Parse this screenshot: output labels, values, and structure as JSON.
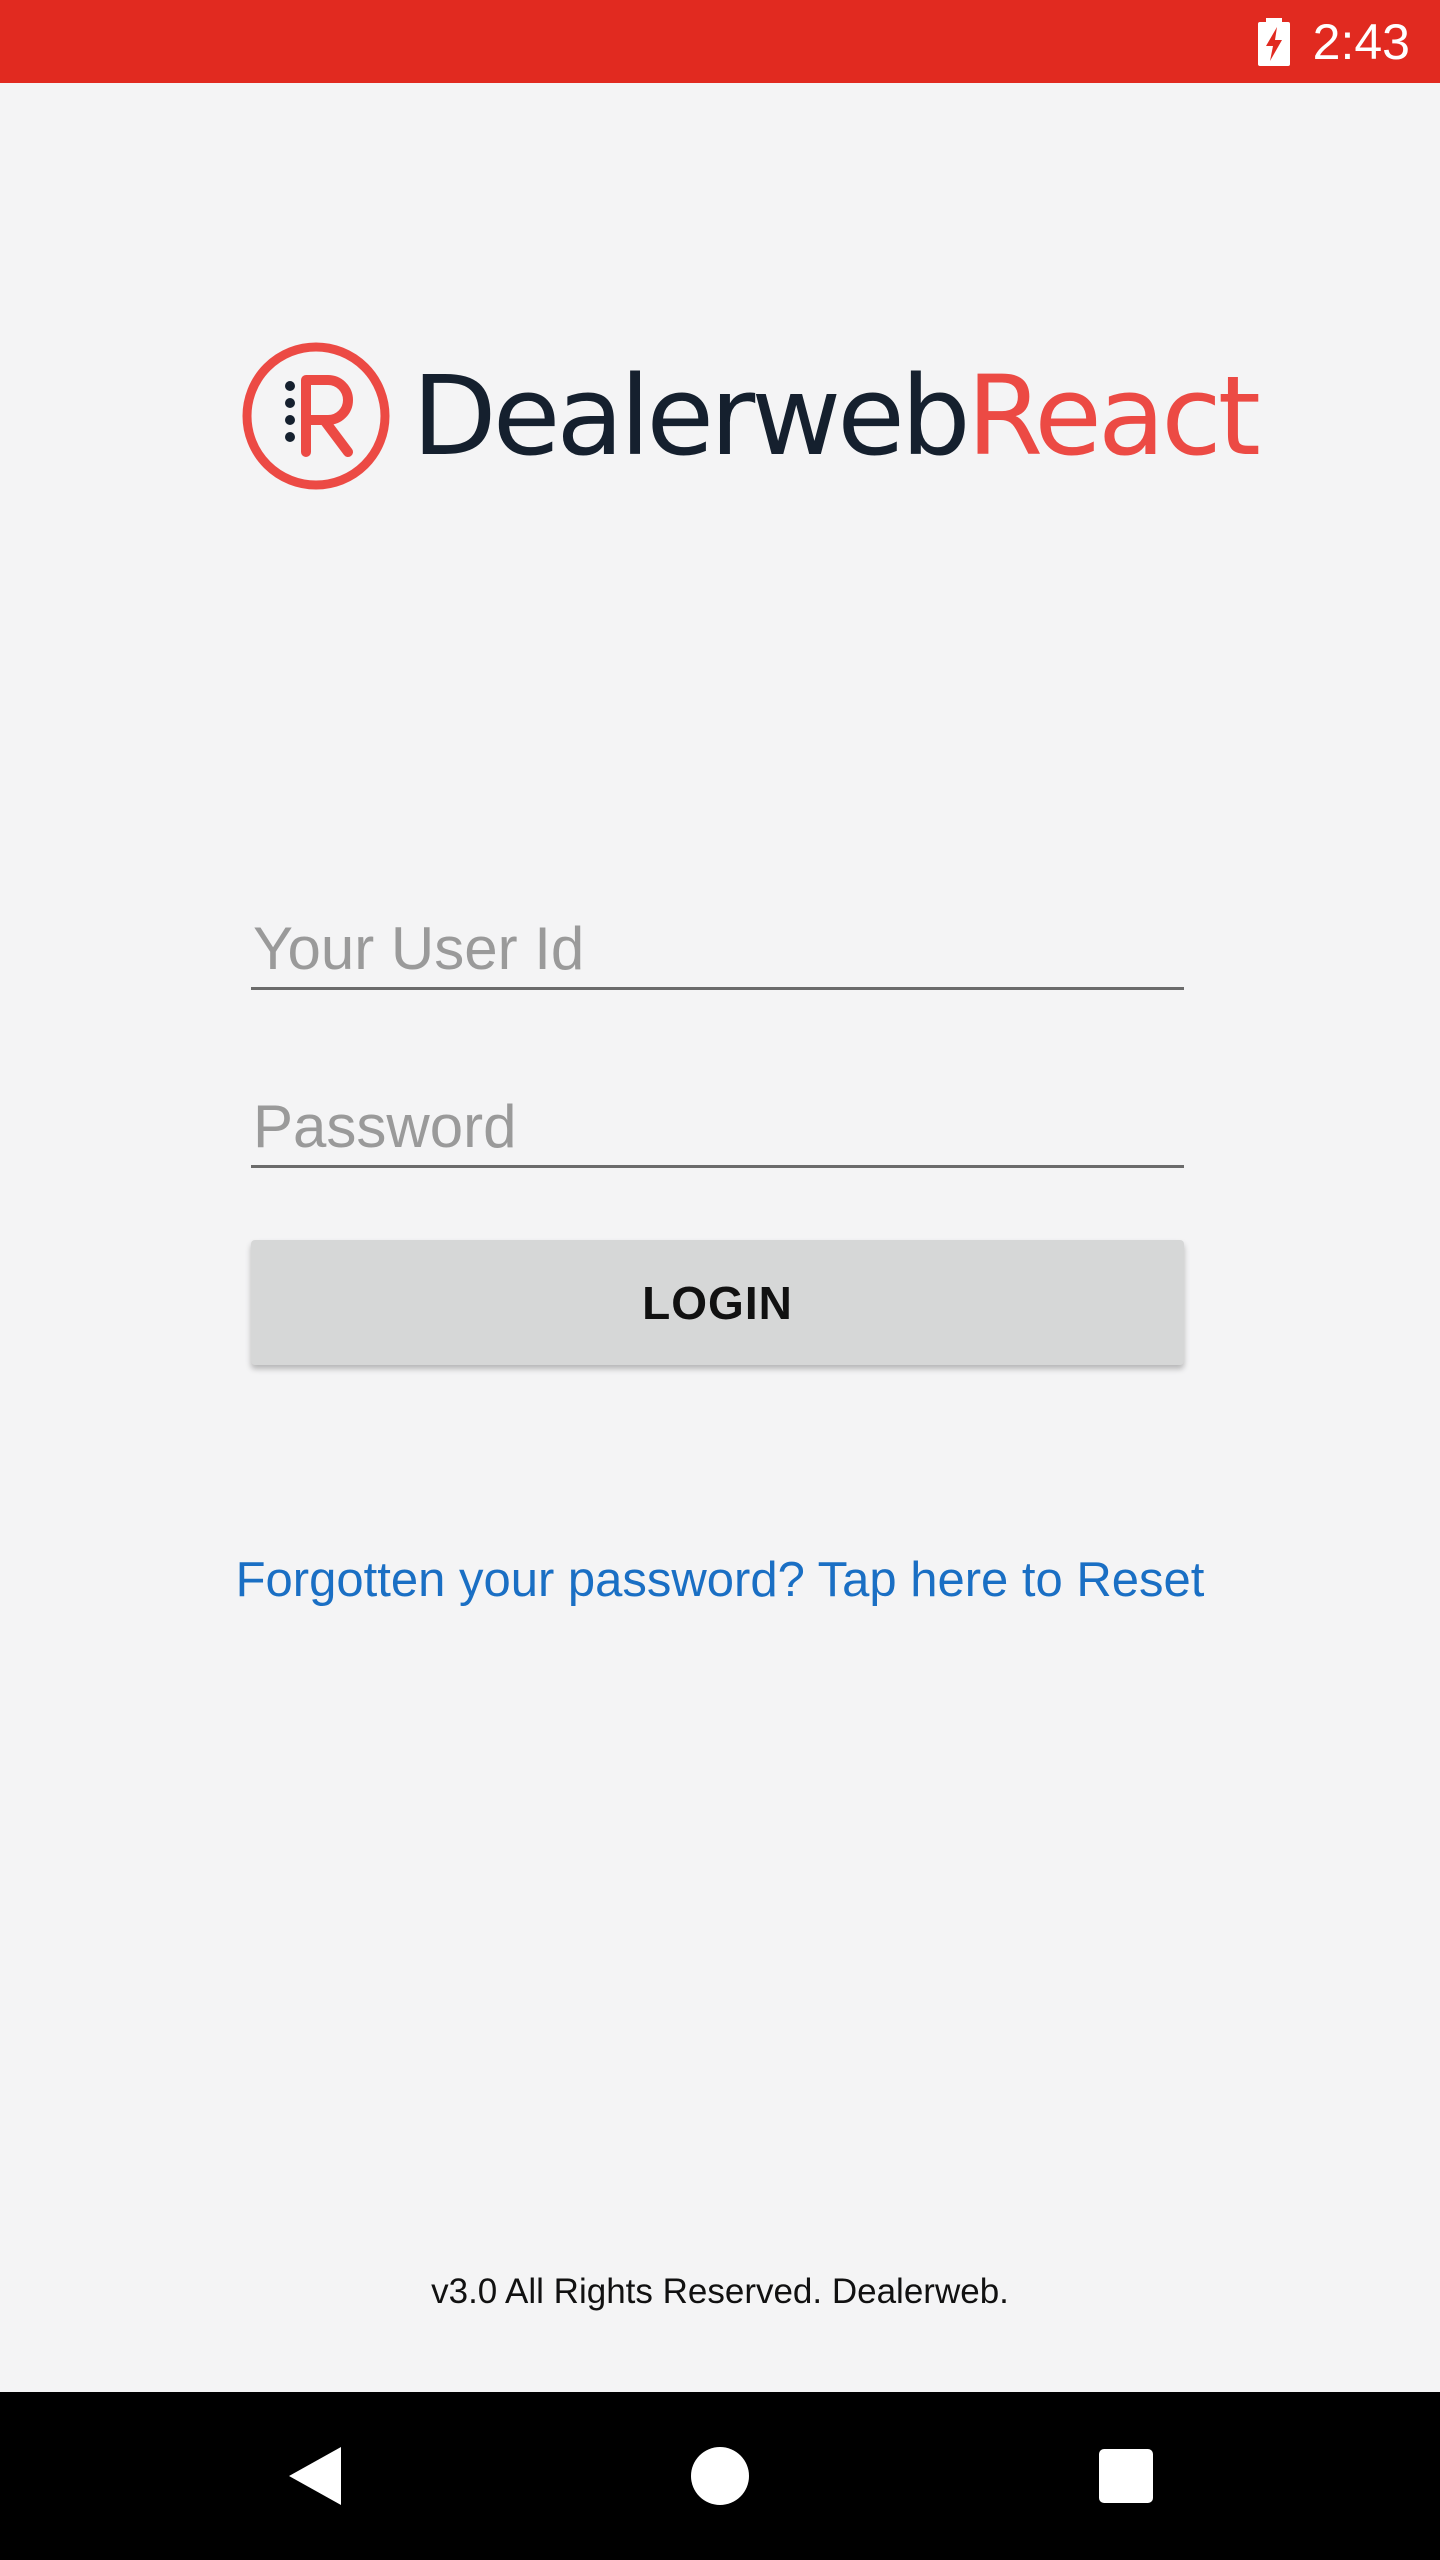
{
  "status_bar": {
    "time": "2:43",
    "battery_icon": "battery-charging-icon",
    "background_color": "#e12a20"
  },
  "logo": {
    "text_dark": "Dealerweb",
    "text_accent": "React",
    "mark_icon": "dealerweb-react-logo-icon",
    "dark_color": "#15202e",
    "accent_color": "#ec4a44"
  },
  "form": {
    "user_id": {
      "value": "",
      "placeholder": "Your User Id"
    },
    "password": {
      "value": "",
      "placeholder": "Password"
    },
    "login_label": "LOGIN"
  },
  "forgot_password_link": "Forgotten your password? Tap here to Reset",
  "footer_text": "v3.0 All Rights Reserved. Dealerweb.",
  "nav_bar": {
    "back_icon": "back-triangle-icon",
    "home_icon": "home-circle-icon",
    "recents_icon": "recents-square-icon"
  },
  "colors": {
    "link": "#1a6fc4",
    "button_bg": "#d6d7d7"
  }
}
